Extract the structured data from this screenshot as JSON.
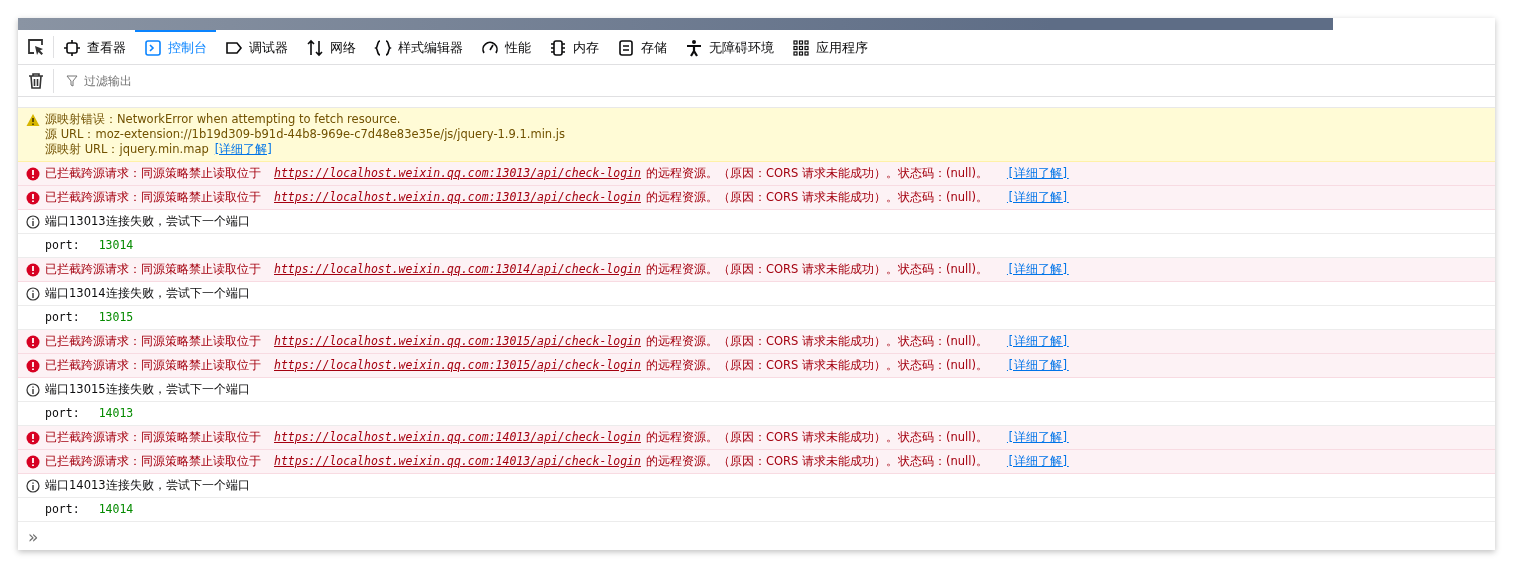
{
  "tabs": [
    {
      "kind": "inspector",
      "label": "查看器",
      "selected": false
    },
    {
      "kind": "console",
      "label": "控制台",
      "selected": true
    },
    {
      "kind": "debugger",
      "label": "调试器",
      "selected": false
    },
    {
      "kind": "network",
      "label": "网络",
      "selected": false
    },
    {
      "kind": "style",
      "label": "样式编辑器",
      "selected": false
    },
    {
      "kind": "performance",
      "label": "性能",
      "selected": false
    },
    {
      "kind": "memory",
      "label": "内存",
      "selected": false
    },
    {
      "kind": "storage",
      "label": "存储",
      "selected": false
    },
    {
      "kind": "accessibility",
      "label": "无障碍环境",
      "selected": false
    },
    {
      "kind": "apps",
      "label": "应用程序",
      "selected": false
    }
  ],
  "filter": {
    "placeholder": "过滤输出"
  },
  "messages": [
    {
      "kind": "warning",
      "lines": [
        "源映射错误：NetworkError when attempting to fetch resource.",
        "源 URL：moz-extension://1b19d309-b91d-44b8-969e-c7d48e83e35e/js/jquery-1.9.1.min.js",
        "源映射 URL：jquery.min.map"
      ],
      "link": "[详细了解]"
    },
    {
      "kind": "error",
      "text": "已拦截跨源请求：同源策略禁止读取位于",
      "url": "https://localhost.weixin.qq.com:13013/api/check-login",
      "suffix": "的远程资源。（原因：CORS 请求未能成功）。状态码：(null)。",
      "link": "[详细了解]"
    },
    {
      "kind": "error",
      "text": "已拦截跨源请求：同源策略禁止读取位于",
      "url": "https://localhost.weixin.qq.com:13013/api/check-login",
      "suffix": "的远程资源。（原因：CORS 请求未能成功）。状态码：(null)。",
      "link": "[详细了解]"
    },
    {
      "kind": "info",
      "text": "端口13013连接失败，尝试下一个端口"
    },
    {
      "kind": "log",
      "label": "port:",
      "value": "13014"
    },
    {
      "kind": "error",
      "text": "已拦截跨源请求：同源策略禁止读取位于",
      "url": "https://localhost.weixin.qq.com:13014/api/check-login",
      "suffix": "的远程资源。（原因：CORS 请求未能成功）。状态码：(null)。",
      "link": "[详细了解]"
    },
    {
      "kind": "info",
      "text": "端口13014连接失败，尝试下一个端口"
    },
    {
      "kind": "log",
      "label": "port:",
      "value": "13015"
    },
    {
      "kind": "error",
      "text": "已拦截跨源请求：同源策略禁止读取位于",
      "url": "https://localhost.weixin.qq.com:13015/api/check-login",
      "suffix": "的远程资源。（原因：CORS 请求未能成功）。状态码：(null)。",
      "link": "[详细了解]"
    },
    {
      "kind": "error",
      "text": "已拦截跨源请求：同源策略禁止读取位于",
      "url": "https://localhost.weixin.qq.com:13015/api/check-login",
      "suffix": "的远程资源。（原因：CORS 请求未能成功）。状态码：(null)。",
      "link": "[详细了解]"
    },
    {
      "kind": "info",
      "text": "端口13015连接失败，尝试下一个端口"
    },
    {
      "kind": "log",
      "label": "port:",
      "value": "14013"
    },
    {
      "kind": "error",
      "text": "已拦截跨源请求：同源策略禁止读取位于",
      "url": "https://localhost.weixin.qq.com:14013/api/check-login",
      "suffix": "的远程资源。（原因：CORS 请求未能成功）。状态码：(null)。",
      "link": "[详细了解]"
    },
    {
      "kind": "error",
      "text": "已拦截跨源请求：同源策略禁止读取位于",
      "url": "https://localhost.weixin.qq.com:14013/api/check-login",
      "suffix": "的远程资源。（原因：CORS 请求未能成功）。状态码：(null)。",
      "link": "[详细了解]"
    },
    {
      "kind": "info",
      "text": "端口14013连接失败，尝试下一个端口"
    },
    {
      "kind": "log",
      "label": "port:",
      "value": "14014"
    }
  ],
  "input": {
    "prompt": "»"
  }
}
